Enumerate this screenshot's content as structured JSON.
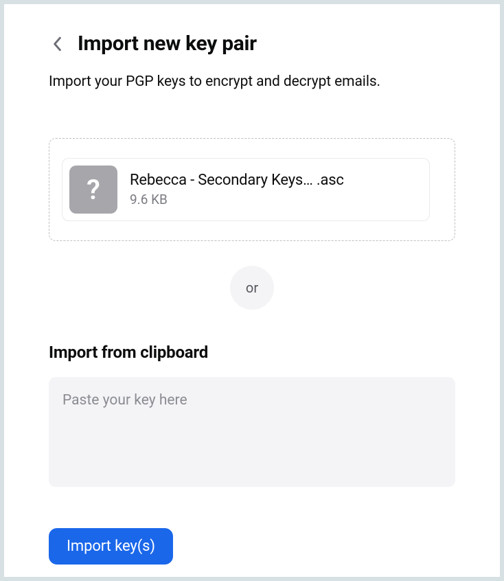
{
  "header": {
    "title": "Import new key pair",
    "subtitle": "Import your PGP keys to encrypt and decrypt emails."
  },
  "dropzone": {
    "file": {
      "icon_glyph": "?",
      "name": "Rebecca - Secondary Keys… .asc",
      "size": "9.6 KB"
    }
  },
  "separator": {
    "label": "or"
  },
  "clipboard": {
    "title": "Import from clipboard",
    "placeholder": "Paste your key here",
    "value": ""
  },
  "actions": {
    "import_label": "Import key(s)"
  }
}
